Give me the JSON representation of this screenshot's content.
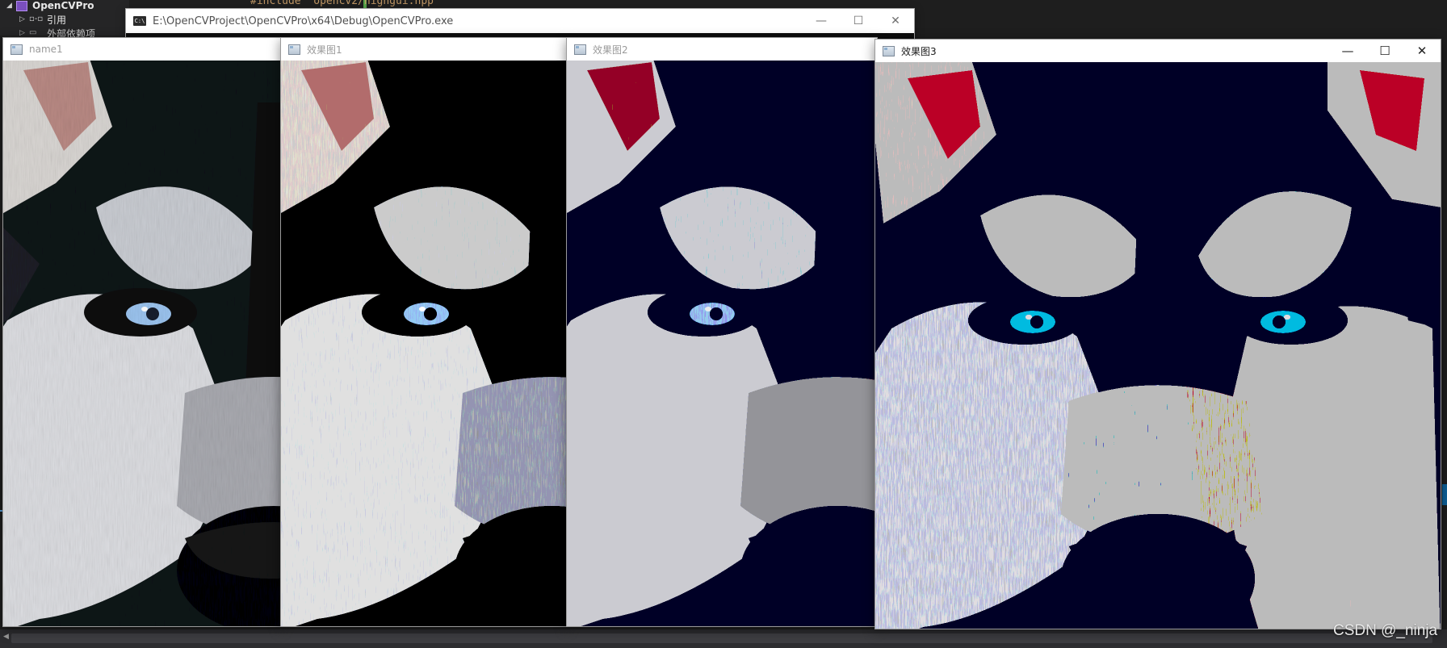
{
  "ide": {
    "project_name": "OpenCVPro",
    "tree_ref": "引用",
    "tree_external": "外部依赖项",
    "code_snippet": "#include \"opencv2/highgui.hpp\""
  },
  "console": {
    "title": "E:\\OpenCVProject\\OpenCVPro\\x64\\Debug\\OpenCVPro.exe",
    "icon": "console-app-icon"
  },
  "windows": [
    {
      "title": "name1",
      "style": "original"
    },
    {
      "title": "效果图1",
      "style": "quant-fine"
    },
    {
      "title": "效果图2",
      "style": "quant-mid"
    },
    {
      "title": "效果图3",
      "style": "quant-coarse"
    }
  ],
  "controls": {
    "minimize": "—",
    "maximize": "☐",
    "close": "✕"
  },
  "watermark": "CSDN @_ninja",
  "colors": {
    "ide_bg": "#1e1e1e",
    "console_bg": "#0c0c0c",
    "eye_blue": "#9cc4ef"
  }
}
